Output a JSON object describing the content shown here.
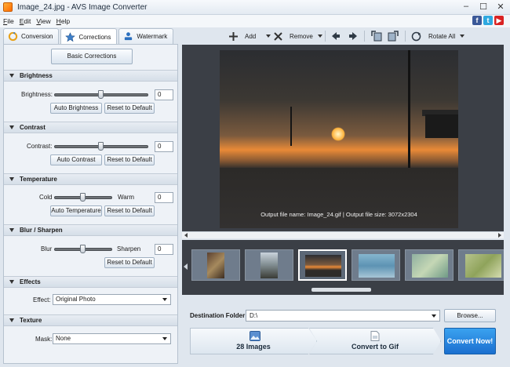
{
  "window": {
    "title": "Image_24.jpg - AVS Image Converter",
    "controls": [
      "–",
      "☐",
      "✕"
    ]
  },
  "menu": [
    {
      "key": "F",
      "rest": "ile"
    },
    {
      "key": "E",
      "rest": "dit"
    },
    {
      "key": "V",
      "rest": "iew"
    },
    {
      "key": "H",
      "rest": "elp"
    }
  ],
  "social": {
    "facebook": "f",
    "twitter": "t",
    "youtube": "▶"
  },
  "tabs": [
    {
      "label": "Conversion",
      "icon": "conversion-icon"
    },
    {
      "label": "Corrections",
      "icon": "star-icon"
    },
    {
      "label": "Watermark",
      "icon": "watermark-icon"
    }
  ],
  "left": {
    "basic_button": "Basic Corrections",
    "brightness": {
      "title": "Brightness",
      "label": "Brightness:",
      "value": "0",
      "auto": "Auto Brightness",
      "reset": "Reset to Default",
      "level": 0.5
    },
    "contrast": {
      "title": "Contrast",
      "label": "Contrast:",
      "value": "0",
      "auto": "Auto Contrast",
      "reset": "Reset to Default",
      "level": 0.5
    },
    "temperature": {
      "title": "Temperature",
      "left": "Cold",
      "right": "Warm",
      "value": "0",
      "auto": "Auto Temperature",
      "reset": "Reset to Default",
      "level": 0.5
    },
    "blur": {
      "title": "Blur / Sharpen",
      "left": "Blur",
      "right": "Sharpen",
      "value": "0",
      "reset": "Reset to Default",
      "level": 0.5
    },
    "effects": {
      "title": "Effects",
      "label": "Effect:",
      "value": "Original Photo"
    },
    "texture": {
      "title": "Texture",
      "label": "Mask:",
      "value": "None"
    }
  },
  "toolbar": {
    "add": "Add",
    "remove": "Remove",
    "rotate_all": "Rotate All"
  },
  "preview": {
    "caption": "Output file name: Image_24.gif | Output file size: 3072x2304"
  },
  "bottom": {
    "dest_label": "Destination Folder:",
    "dest_value": "D:\\",
    "browse": "Browse...",
    "step1": "28 Images",
    "step2": "Convert to Gif",
    "convert": "Convert Now!"
  },
  "colors": {
    "accent": "#1b6fcf",
    "panel": "#eef2f7",
    "preview_bg": "#3b3f46"
  }
}
